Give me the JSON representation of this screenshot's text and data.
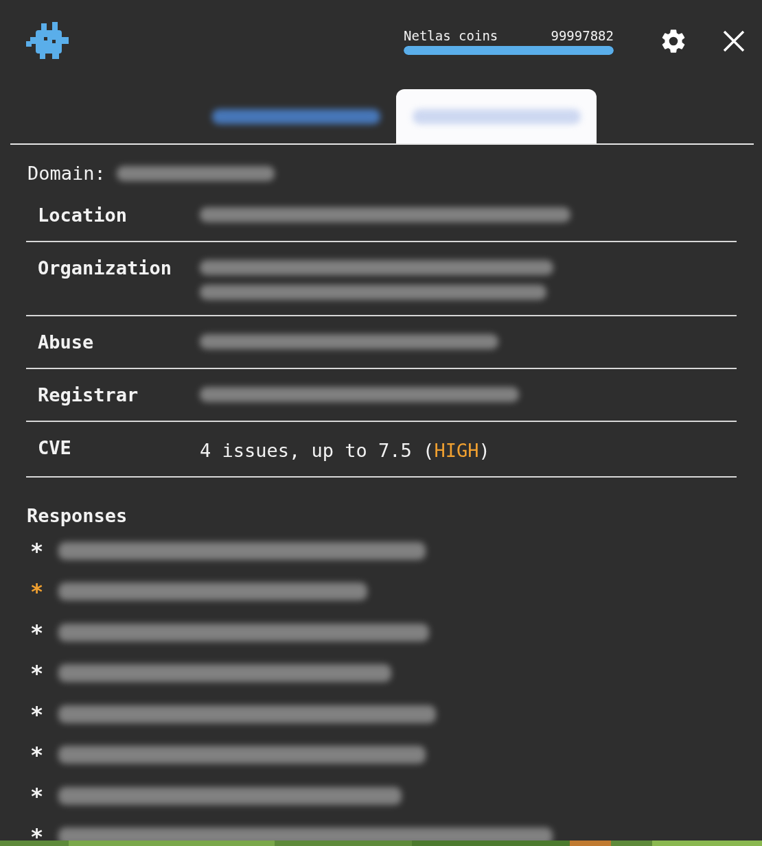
{
  "header": {
    "coins_label": "Netlas coins",
    "coins_value": "99997882",
    "level": 1
  },
  "tabs": [
    {
      "kind": "redacted",
      "selected": false
    },
    {
      "kind": "redacted",
      "selected": true
    }
  ],
  "domain": {
    "label": "Domain:",
    "value": {
      "kind": "redacted"
    }
  },
  "fields": [
    {
      "label": "Location",
      "value_parts": [
        {
          "kind": "redacted"
        }
      ]
    },
    {
      "label": "Organization",
      "value_parts": [
        {
          "kind": "redacted"
        },
        {
          "kind": "redacted"
        }
      ]
    },
    {
      "label": "Abuse",
      "value_parts": [
        {
          "kind": "redacted"
        }
      ]
    },
    {
      "label": "Registrar",
      "value_parts": [
        {
          "kind": "redacted"
        }
      ]
    },
    {
      "label": "CVE",
      "value_parts": [
        {
          "kind": "text",
          "text": "4 issues, up to 7.5 ("
        },
        {
          "kind": "severity",
          "text": "HIGH"
        },
        {
          "kind": "text",
          "text": ")"
        }
      ]
    }
  ],
  "responses": {
    "title": "Responses",
    "items": [
      {
        "marker": "*",
        "highlighted": false
      },
      {
        "marker": "*",
        "highlighted": true
      },
      {
        "marker": "*",
        "highlighted": false
      },
      {
        "marker": "*",
        "highlighted": false
      },
      {
        "marker": "*",
        "highlighted": false
      },
      {
        "marker": "*",
        "highlighted": false
      },
      {
        "marker": "*",
        "highlighted": false
      },
      {
        "marker": "*",
        "highlighted": false
      }
    ]
  }
}
